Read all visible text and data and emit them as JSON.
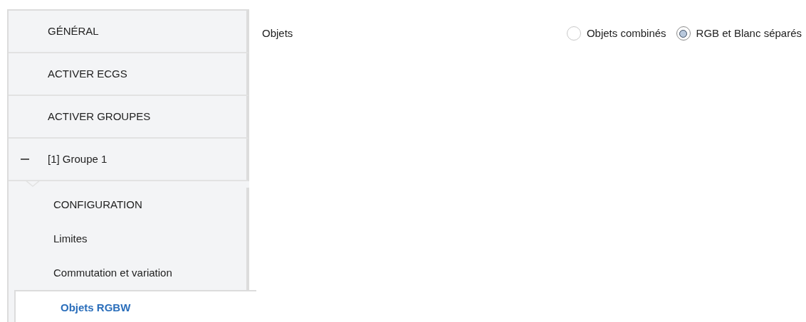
{
  "sidebar": {
    "items": [
      {
        "label": "GÉNÉRAL",
        "selected": false
      },
      {
        "label": "ACTIVER ECGS",
        "selected": false
      },
      {
        "label": "ACTIVER GROUPES",
        "selected": false
      },
      {
        "label": "[1] Groupe 1",
        "selected": false,
        "expanded": true,
        "children": [
          {
            "label": "CONFIGURATION",
            "selected": false
          },
          {
            "label": "Limites",
            "selected": false
          },
          {
            "label": "Commutation et variation",
            "selected": false
          },
          {
            "label": "Objets RGBW",
            "selected": true
          }
        ]
      }
    ]
  },
  "content": {
    "rows": [
      {
        "label": "Objets",
        "options": [
          {
            "label": "Objets combinés",
            "selected": false
          },
          {
            "label": "RGB et Blanc séparés",
            "selected": true
          }
        ]
      }
    ]
  }
}
